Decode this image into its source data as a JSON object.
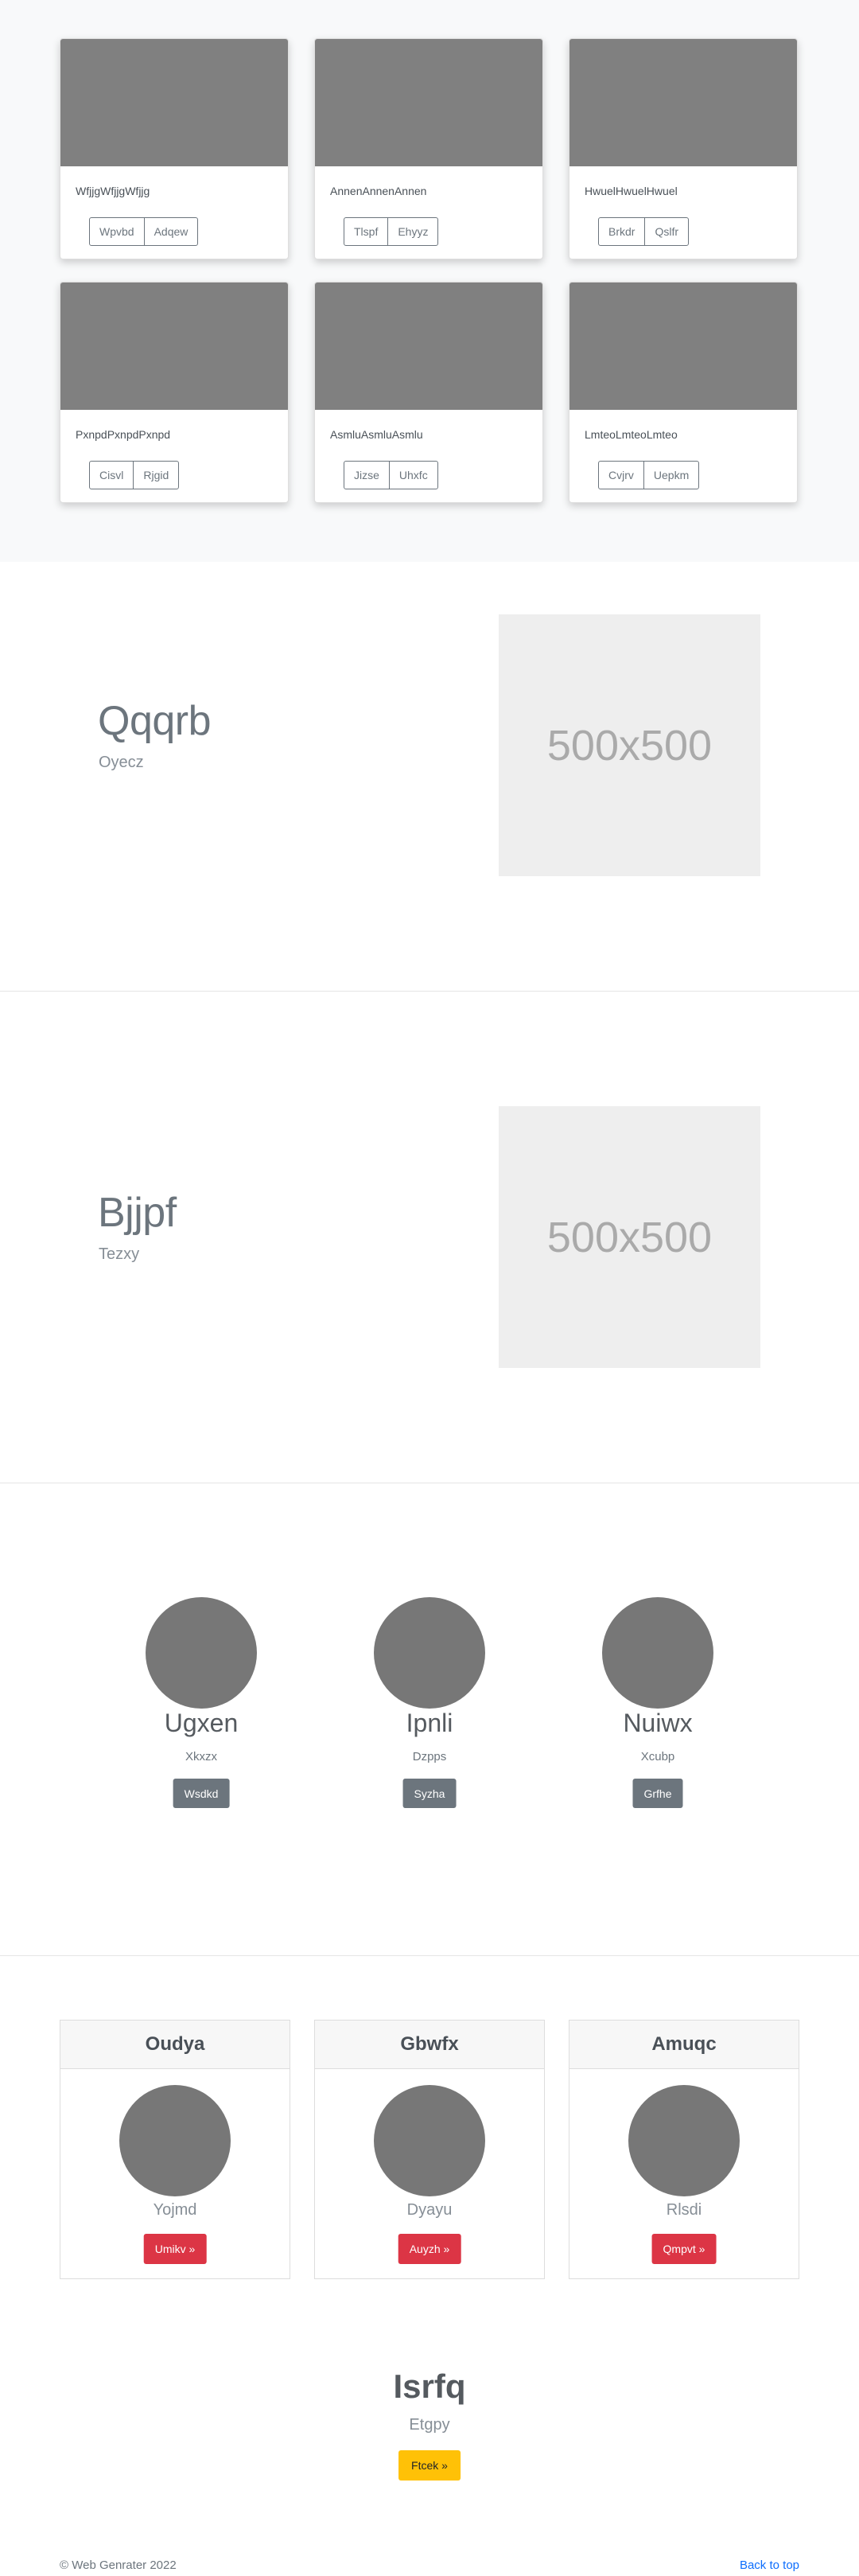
{
  "album": {
    "cards": [
      {
        "text": "WfjjgWfjjgWfjjg",
        "buttons": [
          "Wpvbd",
          "Adqew"
        ]
      },
      {
        "text": "AnnenAnnenAnnen",
        "buttons": [
          "Tlspf",
          "Ehyyz"
        ]
      },
      {
        "text": "HwuelHwuelHwuel",
        "buttons": [
          "Brkdr",
          "Qslfr"
        ]
      },
      {
        "text": "PxnpdPxnpdPxnpd",
        "buttons": [
          "Cisvl",
          "Rjgid"
        ]
      },
      {
        "text": "AsmluAsmluAsmlu",
        "buttons": [
          "Jizse",
          "Uhxfc"
        ]
      },
      {
        "text": "LmteoLmteoLmteo",
        "buttons": [
          "Cvjrv",
          "Uepkm"
        ]
      }
    ]
  },
  "featurettes": [
    {
      "heading": "Qqqrb",
      "lead": "Oyecz",
      "image_label": "500x500"
    },
    {
      "heading": "Bjjpf",
      "lead": "Tezxy",
      "image_label": "500x500"
    }
  ],
  "marketing": {
    "items": [
      {
        "name": "Ugxen",
        "sub": "Xkxzx",
        "button": "Wsdkd"
      },
      {
        "name": "Ipnli",
        "sub": "Dzpps",
        "button": "Syzha"
      },
      {
        "name": "Nuiwx",
        "sub": "Xcubp",
        "button": "Grfhe"
      }
    ]
  },
  "cards": {
    "items": [
      {
        "header": "Oudya",
        "text": "Yojmd",
        "button": "Umikv »"
      },
      {
        "header": "Gbwfx",
        "text": "Dyayu",
        "button": "Auyzh »"
      },
      {
        "header": "Amuqc",
        "text": "Rlsdi",
        "button": "Qmpvt »"
      }
    ]
  },
  "cta": {
    "title": "Isrfq",
    "subtitle": "Etgpy",
    "button": "Ftcek »"
  },
  "footer": {
    "copyright": "© Web Genrater 2022",
    "back_to_top": "Back to top"
  },
  "colors": {
    "album_bg": "#f8f9fa",
    "thumb": "#808080",
    "circle": "#777777",
    "secondary": "#6c757d",
    "danger": "#dc3545",
    "warning": "#ffc107",
    "link": "#0d6efd"
  }
}
